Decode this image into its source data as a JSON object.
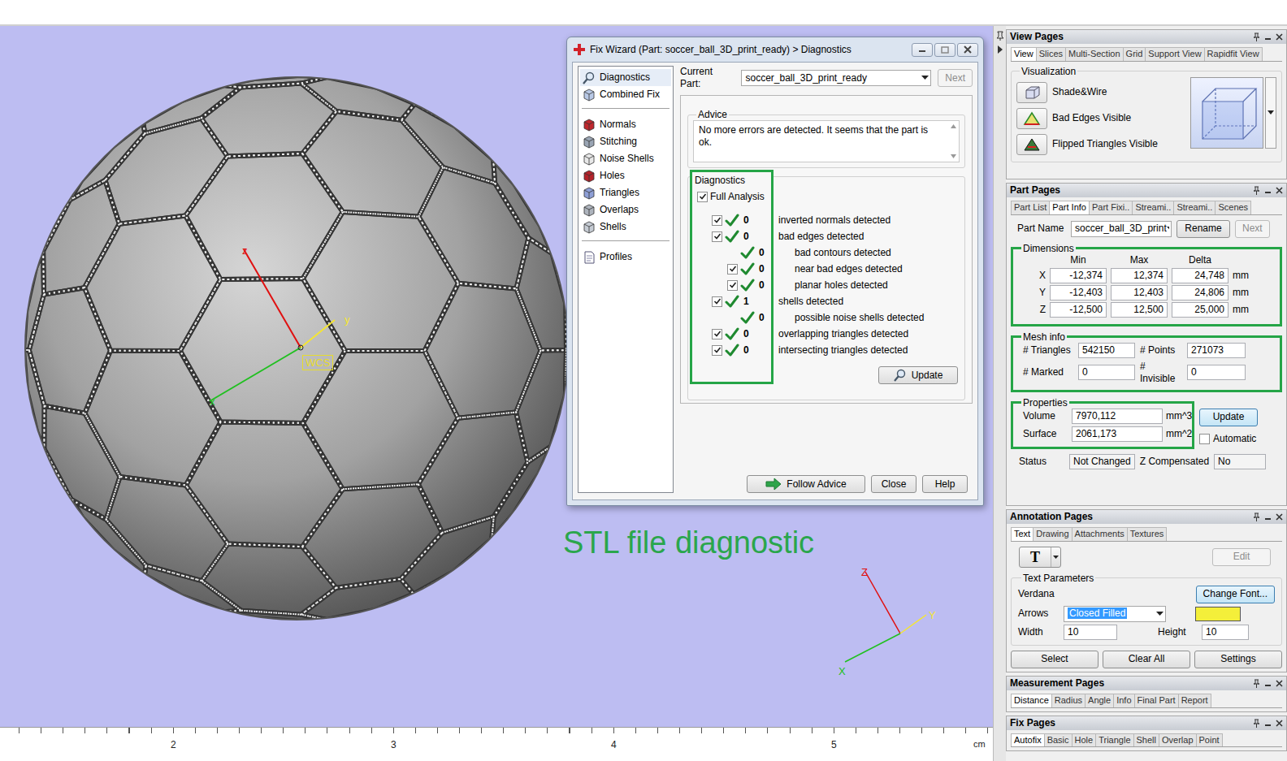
{
  "viewport": {
    "caption": "STL file diagnostic",
    "wcs": {
      "label": "WCS",
      "z": "z",
      "y": "y",
      "x": "x"
    },
    "triad": {
      "z": "Z",
      "y": "Y",
      "x": "X"
    },
    "ruler": {
      "ticks": [
        "2",
        "3",
        "4",
        "5"
      ],
      "unit": "cm"
    }
  },
  "dialog": {
    "title": "Fix Wizard (Part: soccer_ball_3D_print_ready) > Diagnostics",
    "nav_groups": [
      [
        {
          "label": "Diagnostics",
          "selected": true
        },
        {
          "label": "Combined Fix",
          "selected": false
        }
      ],
      [
        {
          "label": "Normals",
          "selected": false
        },
        {
          "label": "Stitching",
          "selected": false
        },
        {
          "label": "Noise Shells",
          "selected": false
        },
        {
          "label": "Holes",
          "selected": false
        },
        {
          "label": "Triangles",
          "selected": false
        },
        {
          "label": "Overlaps",
          "selected": false
        },
        {
          "label": "Shells",
          "selected": false
        }
      ],
      [
        {
          "label": "Profiles",
          "selected": false
        }
      ]
    ],
    "current_part_label": "Current Part:",
    "current_part": "soccer_ball_3D_print_ready",
    "next": {
      "label": "Next",
      "disabled": true
    },
    "advice": {
      "title": "Advice",
      "text": "No more errors are detected. It seems that the part is ok."
    },
    "diagnostics": {
      "title": "Diagnostics",
      "full_analysis": {
        "label": "Full Analysis",
        "checked": true
      },
      "rows": [
        {
          "kind": "checkbox",
          "checked": true,
          "depth": 0,
          "count": "0",
          "label": "inverted normals detected"
        },
        {
          "kind": "checkbox",
          "checked": true,
          "depth": 0,
          "count": "0",
          "label": "bad edges detected"
        },
        {
          "kind": "plain",
          "depth": 1,
          "count": "0",
          "label": "bad contours detected"
        },
        {
          "kind": "checkbox",
          "checked": true,
          "depth": 1,
          "count": "0",
          "label": "near bad edges detected"
        },
        {
          "kind": "checkbox",
          "checked": true,
          "depth": 1,
          "count": "0",
          "label": "planar holes detected"
        },
        {
          "kind": "checkbox",
          "checked": true,
          "depth": 0,
          "count": "1",
          "label": "shells detected"
        },
        {
          "kind": "plain",
          "depth": 1,
          "count": "0",
          "label": "possible noise shells detected"
        },
        {
          "kind": "checkbox",
          "checked": true,
          "depth": 0,
          "count": "0",
          "label": "overlapping triangles detected"
        },
        {
          "kind": "checkbox",
          "checked": true,
          "depth": 0,
          "count": "0",
          "label": "intersecting triangles detected"
        }
      ],
      "update": "Update"
    },
    "buttons": [
      "Follow Advice",
      "Close",
      "Help"
    ]
  },
  "view_pages": {
    "title": "View Pages",
    "tabs": [
      {
        "label": "View",
        "selected": true
      },
      {
        "label": "Slices",
        "selected": false
      },
      {
        "label": "Multi-Section",
        "selected": false
      },
      {
        "label": "Grid",
        "selected": false
      },
      {
        "label": "Support View",
        "selected": false
      },
      {
        "label": "Rapidfit View",
        "selected": false
      }
    ],
    "visualization": {
      "title": "Visualization",
      "items": [
        "Shade&Wire",
        "Bad Edges Visible",
        "Flipped Triangles Visible"
      ]
    }
  },
  "part_pages": {
    "title": "Part Pages",
    "tabs": [
      {
        "label": "Part List",
        "selected": false
      },
      {
        "label": "Part Info",
        "selected": true
      },
      {
        "label": "Part Fixi..",
        "selected": false
      },
      {
        "label": "Streami..",
        "selected": false
      },
      {
        "label": "Streami..",
        "selected": false
      },
      {
        "label": "Scenes",
        "selected": false
      }
    ],
    "part_name_label": "Part Name",
    "part_name": "soccer_ball_3D_print",
    "rename": "Rename",
    "next": {
      "label": "Next",
      "disabled": true
    },
    "dimensions": {
      "title": "Dimensions",
      "columns": [
        "Min",
        "Max",
        "Delta"
      ],
      "rows": [
        {
          "axis": "X",
          "min": "-12,374",
          "max": "12,374",
          "delta": "24,748",
          "unit": "mm"
        },
        {
          "axis": "Y",
          "min": "-12,403",
          "max": "12,403",
          "delta": "24,806",
          "unit": "mm"
        },
        {
          "axis": "Z",
          "min": "-12,500",
          "max": "12,500",
          "delta": "25,000",
          "unit": "mm"
        }
      ]
    },
    "mesh": {
      "title": "Mesh info",
      "fields": [
        {
          "label": "# Triangles",
          "value": "542150"
        },
        {
          "label": "# Points",
          "value": "271073"
        },
        {
          "label": "# Marked",
          "value": "0"
        },
        {
          "label": "# Invisible",
          "value": "0"
        }
      ]
    },
    "properties": {
      "title": "Properties",
      "fields": [
        {
          "label": "Volume",
          "value": "7970,112",
          "unit": "mm^3"
        },
        {
          "label": "Surface",
          "value": "2061,173",
          "unit": "mm^2"
        }
      ],
      "update": {
        "label": "Update",
        "focused": true
      },
      "automatic": {
        "label": "Automatic",
        "checked": false
      }
    },
    "status": {
      "label": "Status",
      "value": "Not Changed"
    },
    "z_compensated": {
      "label": "Z Compensated",
      "value": "No"
    }
  },
  "annotation_pages": {
    "title": "Annotation Pages",
    "tabs": [
      {
        "label": "Text",
        "selected": true
      },
      {
        "label": "Drawing",
        "selected": false
      },
      {
        "label": "Attachments",
        "selected": false
      },
      {
        "label": "Textures",
        "selected": false
      }
    ],
    "text_tool": "T",
    "edit": {
      "label": "Edit",
      "disabled": true
    },
    "params_title": "Text Parameters",
    "font": "Verdana",
    "change_font": {
      "label": "Change Font...",
      "focused": true
    },
    "arrows_label": "Arrows",
    "arrows_value": "Closed Filled",
    "arrow_color": "#f4ef3a",
    "width_label": "Width",
    "width": "10",
    "height_label": "Height",
    "height": "10",
    "buttons": [
      "Select",
      "Clear All",
      "Settings"
    ]
  },
  "measurement_pages": {
    "title": "Measurement Pages",
    "tabs": [
      {
        "label": "Distance",
        "selected": true
      },
      {
        "label": "Radius",
        "selected": false
      },
      {
        "label": "Angle",
        "selected": false
      },
      {
        "label": "Info",
        "selected": false
      },
      {
        "label": "Final Part",
        "selected": false
      },
      {
        "label": "Report",
        "selected": false
      }
    ]
  },
  "fix_pages": {
    "title": "Fix Pages",
    "tabs": [
      {
        "label": "Autofix",
        "selected": true
      },
      {
        "label": "Basic",
        "selected": false
      },
      {
        "label": "Hole",
        "selected": false
      },
      {
        "label": "Triangle",
        "selected": false
      },
      {
        "label": "Shell",
        "selected": false
      },
      {
        "label": "Overlap",
        "selected": false
      },
      {
        "label": "Point",
        "selected": false
      }
    ]
  }
}
